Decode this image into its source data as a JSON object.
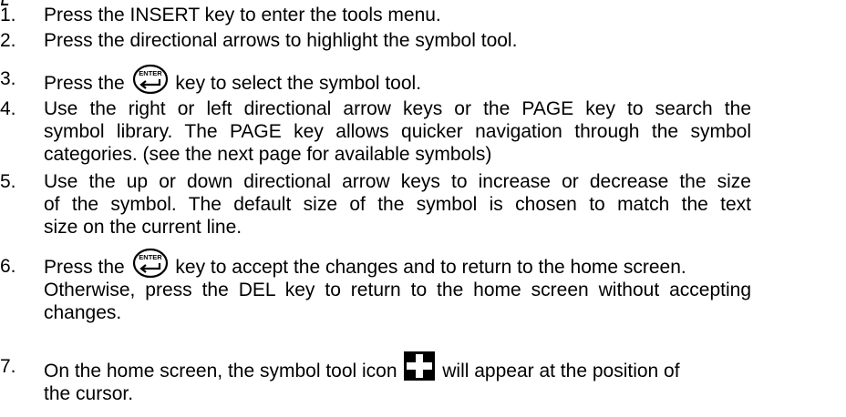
{
  "document": {
    "steps": [
      {
        "number": "1.",
        "lines": [
          "Press the INSERT key to enter the tools menu."
        ]
      },
      {
        "number": "2.",
        "lines": [
          "Press the directional arrows to highlight the symbol tool."
        ]
      },
      {
        "number": "3.",
        "before": "Press the",
        "after": "key to select the symbol tool."
      },
      {
        "number": "4.",
        "lines": [
          "Use the right or left directional arrow keys or the PAGE key to search the",
          "symbol library.  The PAGE key allows quicker navigation through the symbol",
          "categories. (see the next page for available symbols)"
        ]
      },
      {
        "number": "5.",
        "lines": [
          "Use the up or down directional arrow keys to increase or decrease the size",
          "of the symbol.  The default size of the symbol is chosen to match the text",
          "size on the current line."
        ]
      },
      {
        "number": "6.",
        "before": "Press the",
        "after": "key to accept the changes and to return to the home screen.",
        "lines": [
          "Otherwise, press the DEL key to return to the home screen without accepting",
          "changes."
        ]
      },
      {
        "number": "7.",
        "before": "On the home screen, the symbol tool icon",
        "after": "will appear at the position of",
        "lines": [
          "the cursor."
        ]
      }
    ],
    "enter_key_label": "ENTER",
    "icons": {
      "enter_key": "enter-key-icon",
      "symbol_tool": "symbol-tool-icon"
    }
  }
}
